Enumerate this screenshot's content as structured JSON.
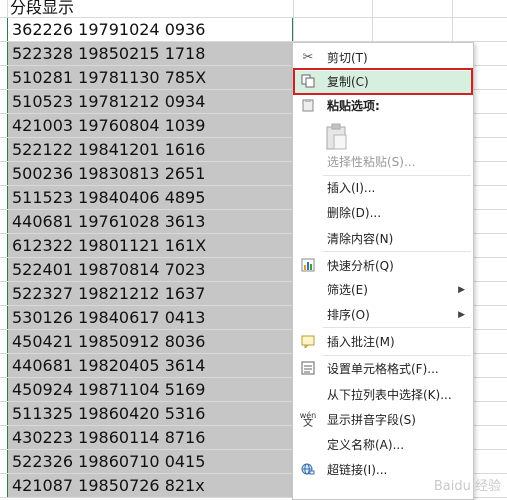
{
  "sheet": {
    "header_text": "分段显示",
    "rows": [
      "362226 19791024 0936",
      "522328 19850215 1718",
      "510281 19781130 785X",
      "510523 19781212 0934",
      "421003 19760804 1039",
      "522122 19841201 1616",
      "500236 19830813 2651",
      "511523 19840406 4895",
      "440681 19761028 3613",
      "612322 19801121 161X",
      "522401 19870814 7023",
      "522327 19821212 1637",
      "530126 19840617 0413",
      "450421 19850912 8036",
      "440681 19820405 3614",
      "450924 19871104 5169",
      "511325 19860420 5316",
      "430223 19860114 8716",
      "522326 19860710 0415",
      "421087 19850726 821x"
    ]
  },
  "context_menu": {
    "cut": "剪切(T)",
    "copy": "复制(C)",
    "paste_options": "粘贴选项:",
    "paste_special": "选择性粘贴(S)...",
    "insert": "插入(I)...",
    "delete": "删除(D)...",
    "clear": "清除内容(N)",
    "quick_analysis": "快速分析(Q)",
    "filter": "筛选(E)",
    "sort": "排序(O)",
    "insert_comment": "插入批注(M)",
    "format_cells": "设置单元格格式(F)...",
    "pick_list": "从下拉列表中选择(K)...",
    "phonetic": "显示拼音字段(S)",
    "define_name": "定义名称(A)...",
    "hyperlink": "超链接(I)...",
    "phonetic_icon_text": "wén",
    "phonetic_icon_char": "文"
  },
  "watermark": "Baidu 经验",
  "colors": {
    "selection_fill": "#c6c6c6",
    "selection_border": "#2e7d4f",
    "hover_fill": "#d7efdf",
    "highlight_border": "#d21f1f"
  }
}
